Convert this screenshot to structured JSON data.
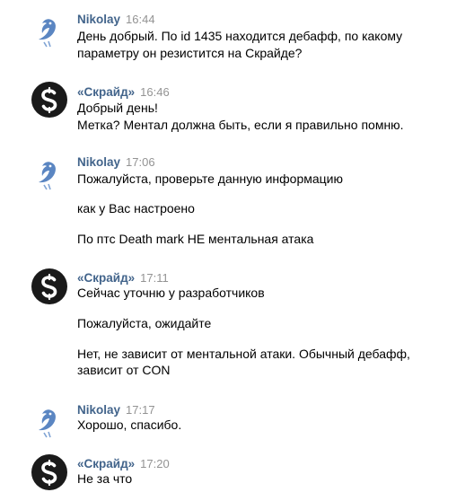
{
  "messages": [
    {
      "author": "Nikolay",
      "time": "16:44",
      "avatar_icon": "bird-avatar-icon",
      "lines": [
        "День добрый. По id 1435 находится дебафф, по какому",
        "параметру он резистится на Скрайде?"
      ]
    },
    {
      "author": "«Скрайд»",
      "time": "16:46",
      "avatar_icon": "skride-logo-avatar-icon",
      "lines": [
        "Добрый день!",
        "Метка? Ментал должна быть, если я правильно помню."
      ]
    },
    {
      "author": "Nikolay",
      "time": "17:06",
      "avatar_icon": "bird-avatar-icon",
      "lines": [
        "Пожалуйста, проверьте данную информацию",
        "как у Вас настроено",
        "По птс Death mark НЕ ментальная атака"
      ]
    },
    {
      "author": "«Скрайд»",
      "time": "17:11",
      "avatar_icon": "skride-logo-avatar-icon",
      "lines": [
        "Сейчас уточню у разработчиков",
        "Пожалуйста, ожидайте",
        "Нет, не зависит от ментальной атаки. Обычный дебафф,",
        "зависит от CON"
      ]
    },
    {
      "author": "Nikolay",
      "time": "17:17",
      "avatar_icon": "bird-avatar-icon",
      "lines": [
        "Хорошо, спасибо."
      ]
    },
    {
      "author": "«Скрайд»",
      "time": "17:20",
      "avatar_icon": "skride-logo-avatar-icon",
      "lines": [
        "Не за что"
      ]
    }
  ],
  "colors": {
    "author": "#42648b",
    "time": "#939393",
    "text": "#000000",
    "bird": "#5b86c2",
    "skride_bg": "#1a1a1a"
  }
}
